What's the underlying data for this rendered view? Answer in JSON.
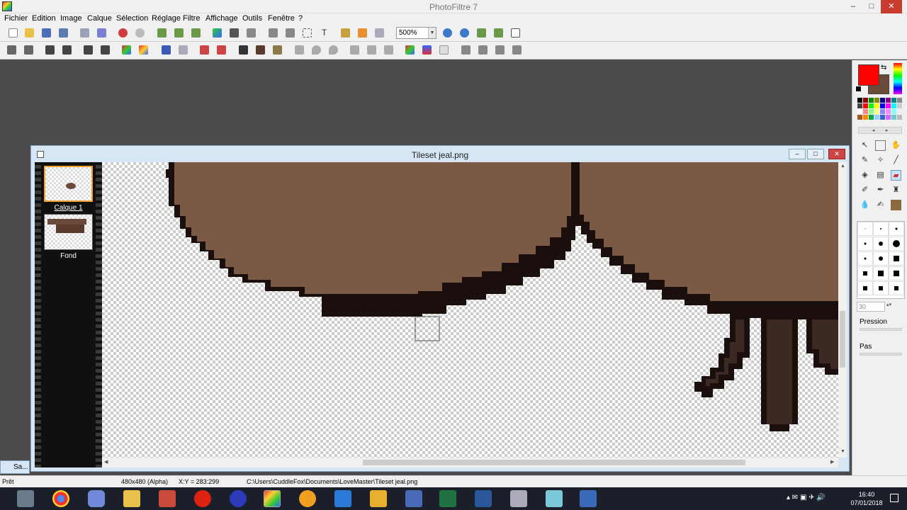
{
  "window": {
    "title": "PhotoFiltre 7",
    "minimize": "–",
    "maximize": "□",
    "close": "✕"
  },
  "menu": [
    "Fichier",
    "Edition",
    "Image",
    "Calque",
    "Sélection",
    "Réglage",
    "Filtre",
    "Affichage",
    "Outils",
    "Fenêtre",
    "?"
  ],
  "toolbar": {
    "zoom": "500%"
  },
  "document": {
    "title": "Tileset jeal.png",
    "minimize": "–",
    "maximize": "□",
    "close": "✕"
  },
  "layers": [
    {
      "name": "Calque 1",
      "selected": true
    },
    {
      "name": "Fond",
      "selected": false
    }
  ],
  "right_panel": {
    "size_value": "30",
    "pression_label": "Pression",
    "pas_label": "Pas"
  },
  "status": {
    "ready": "Prêt",
    "size": "480x480 (Alpha)",
    "coords": "X:Y = 283:299",
    "path": "C:\\Users\\CuddleFox\\Documents\\LoveMaster\\Tileset jeal.png"
  },
  "taskbar": {
    "start_label": "Sa...",
    "time": "16:40",
    "date": "07/01/2018"
  },
  "colors": {
    "foreground": "#ff0000",
    "background": "#6b4a3a",
    "fill": "#7a5a45",
    "outline": "#1a0f0c"
  }
}
